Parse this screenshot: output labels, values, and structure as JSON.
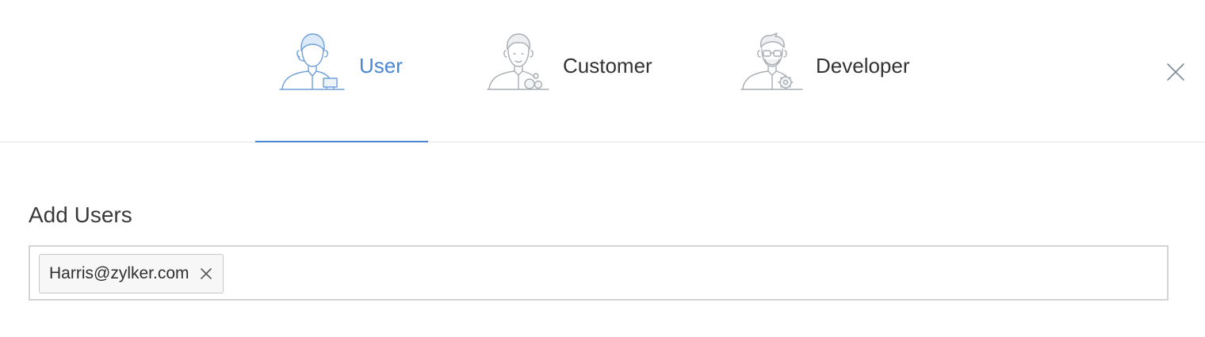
{
  "tabs": [
    {
      "label": "User",
      "icon": "user-avatar-icon",
      "active": true
    },
    {
      "label": "Customer",
      "icon": "customer-avatar-icon",
      "active": false
    },
    {
      "label": "Developer",
      "icon": "developer-avatar-icon",
      "active": false
    }
  ],
  "close": {
    "icon": "close-icon"
  },
  "add_users": {
    "title": "Add Users",
    "tags": [
      {
        "label": "Harris@zylker.com",
        "remove_icon": "close-icon"
      }
    ],
    "input_value": ""
  },
  "colors": {
    "accent": "#4a86d4",
    "text": "#333333",
    "divider": "#e6e6e6",
    "input_border": "#d4d4d4",
    "tag_background": "#f7f7f7",
    "icon_gray": "#a9aeb3"
  }
}
